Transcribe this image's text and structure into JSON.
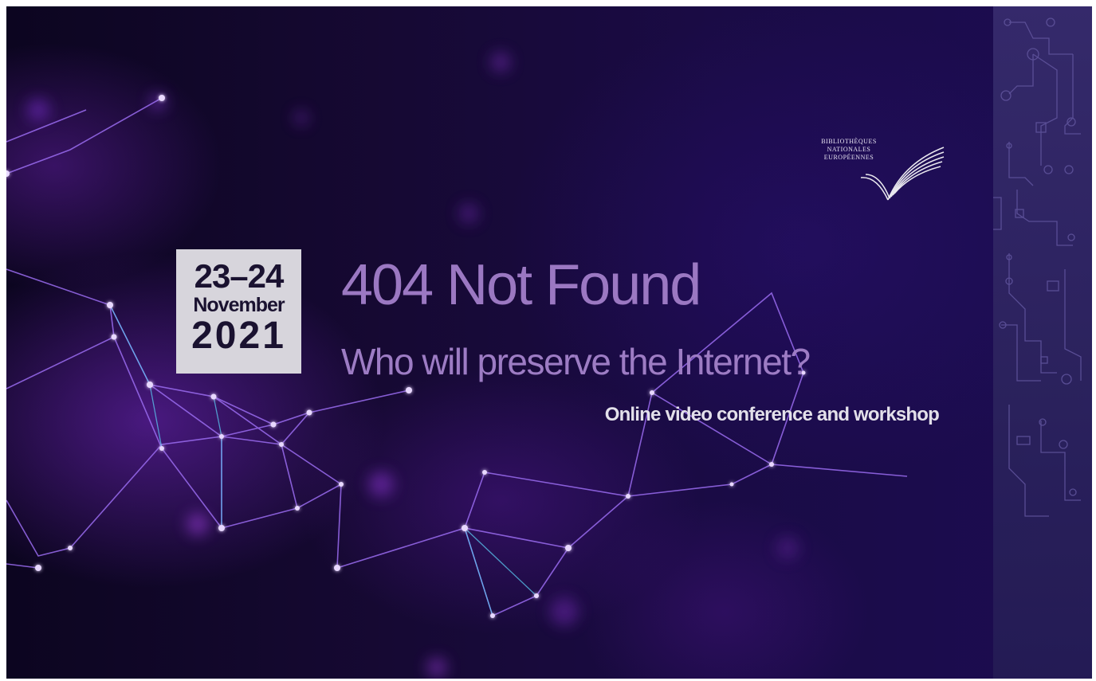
{
  "event": {
    "date_range": "23–24",
    "month": "November",
    "year": "2021",
    "title": "404 Not Found",
    "subtitle": "Who will preserve the Internet?",
    "tagline": "Online video conference and workshop"
  },
  "logo": {
    "lines": [
      "BIBLIOTHÈQUES",
      "NATIONALES",
      "EUROPÉENNES"
    ],
    "icon": "open-book-icon"
  },
  "colors": {
    "title": "#9b78c2",
    "date_box": "#d7d5dc",
    "date_text": "#1a1230",
    "tagline": "#e3e0ea",
    "background": "#1a0b45"
  }
}
